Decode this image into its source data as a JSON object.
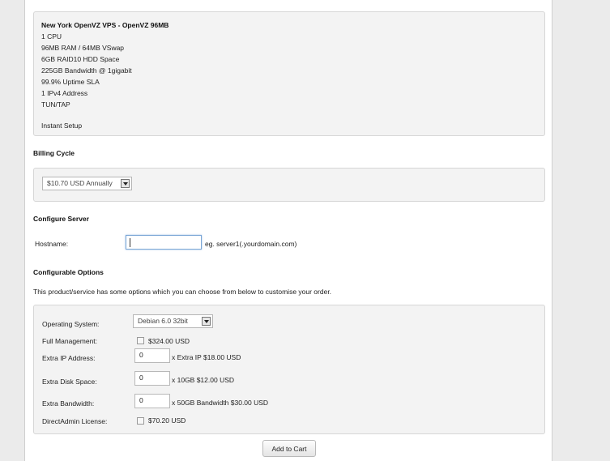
{
  "product": {
    "title": "New York OpenVZ VPS - OpenVZ 96MB",
    "lines": [
      "1 CPU",
      "96MB RAM / 64MB VSwap",
      "6GB RAID10 HDD Space",
      "225GB Bandwidth @ 1gigabit",
      "99.9% Uptime SLA",
      "1 IPv4 Address",
      "TUN/TAP",
      "",
      "Instant Setup"
    ]
  },
  "billing": {
    "heading": "Billing Cycle",
    "selected": "$10.70 USD Annually"
  },
  "server": {
    "heading": "Configure Server",
    "hostname_label": "Hostname:",
    "hostname_value": "",
    "hostname_hint": "eg. server1(.yourdomain.com)"
  },
  "options": {
    "heading": "Configurable Options",
    "intro": "This product/service has some options which you can choose from below to customise your order.",
    "os_label": "Operating System:",
    "os_selected": "Debian 6.0 32bit",
    "mgmt_label": "Full Management:",
    "mgmt_price": "$324.00 USD",
    "ip_label": "Extra IP Address:",
    "ip_value": "0",
    "ip_hint": "x Extra IP $18.00 USD",
    "disk_label": "Extra Disk Space:",
    "disk_value": "0",
    "disk_hint": "x 10GB $12.00 USD",
    "bw_label": "Extra Bandwidth:",
    "bw_value": "0",
    "bw_hint": "x 50GB Bandwidth $30.00 USD",
    "da_label": "DirectAdmin License:",
    "da_price": "$70.20 USD"
  },
  "actions": {
    "add_to_cart": "Add to Cart"
  }
}
